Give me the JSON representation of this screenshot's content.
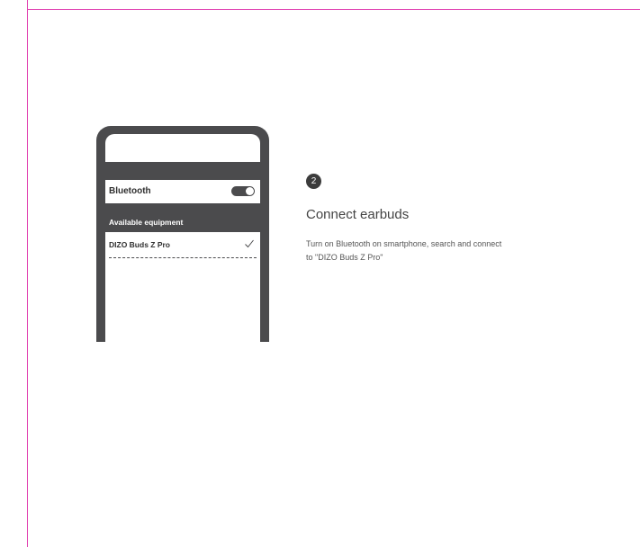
{
  "colors": {
    "trim_line": "#e040b0",
    "phone_body": "#4b4b4d",
    "badge": "#3c3c3c"
  },
  "phone": {
    "bluetooth_label": "Bluetooth",
    "bluetooth_toggle_on": true,
    "available_label": "Available equipment",
    "devices": [
      {
        "name": "DIZO Buds Z Pro",
        "connected": true,
        "status_icon": "check-icon"
      }
    ]
  },
  "step": {
    "number": "2",
    "title": "Connect earbuds",
    "description_line1": "Turn on Bluetooth on smartphone, search and connect",
    "description_line2": "to \"DIZO Buds Z Pro\""
  }
}
